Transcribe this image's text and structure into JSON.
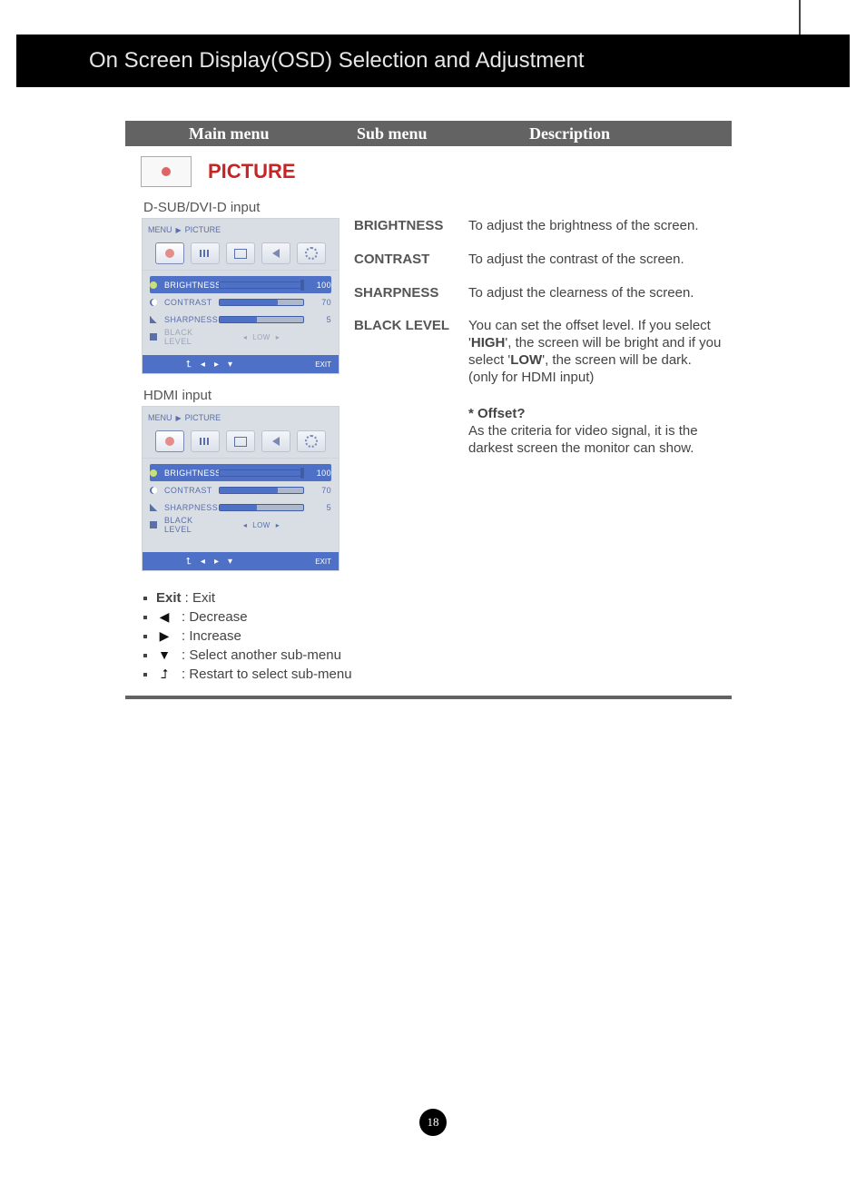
{
  "page_title": "On Screen Display(OSD) Selection and Adjustment",
  "columns": {
    "main": "Main menu",
    "sub": "Sub menu",
    "desc": "Description"
  },
  "section": {
    "name": "PICTURE"
  },
  "input_labels": {
    "dsub": "D-SUB/DVI-D input",
    "hdmi": "HDMI input"
  },
  "osd": {
    "breadcrumb_a": "MENU",
    "breadcrumb_b": "PICTURE",
    "tabs": [
      "brightness",
      "color",
      "screen",
      "audio",
      "setup"
    ],
    "rows": [
      {
        "label": "BRIGHTNESS",
        "value": "100",
        "selected": true,
        "slider": 100,
        "icon": "sun"
      },
      {
        "label": "CONTRAST",
        "value": "70",
        "selected": false,
        "slider": 70,
        "icon": "moon"
      },
      {
        "label": "SHARPNESS",
        "value": "5",
        "selected": false,
        "slider": 40,
        "icon": "sharp"
      },
      {
        "label": "BLACK LEVEL",
        "value": "LOW",
        "selected": false,
        "slider": null,
        "icon": "black",
        "disabled_in_dsub": true
      }
    ],
    "footer": {
      "exit": "EXIT"
    }
  },
  "submenus": [
    {
      "name": "BRIGHTNESS",
      "desc": "To adjust the brightness of the screen."
    },
    {
      "name": "CONTRAST",
      "desc": "To adjust the contrast of the screen."
    },
    {
      "name": "SHARPNESS",
      "desc": "To adjust the clearness of the screen."
    },
    {
      "name": "BLACK LEVEL",
      "desc_pre": "You can set the offset level. If you select '",
      "desc_high": "HIGH",
      "desc_mid": "', the screen will be bright and if you select '",
      "desc_low": "LOW",
      "desc_post": "', the screen will be dark.",
      "note": "(only for HDMI input)",
      "offset_title": "* Offset?",
      "offset_desc": "As the criteria for video signal, it is the darkest screen the monitor can show."
    }
  ],
  "legend": {
    "exit_bold": "Exit",
    "exit_rest": " : Exit",
    "decrease": ": Decrease",
    "increase": ": Increase",
    "down": ": Select another sub-menu",
    "home": ": Restart to select sub-menu"
  },
  "page_number": "18"
}
